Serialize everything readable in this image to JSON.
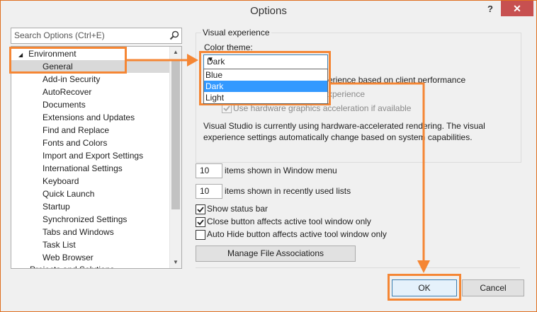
{
  "window": {
    "title": "Options",
    "help": "?",
    "close": "✕"
  },
  "search": {
    "placeholder": "Search Options (Ctrl+E)"
  },
  "tree": {
    "root": "Environment",
    "items": [
      "General",
      "Add-in Security",
      "AutoRecover",
      "Documents",
      "Extensions and Updates",
      "Find and Replace",
      "Fonts and Colors",
      "Import and Export Settings",
      "International Settings",
      "Keyboard",
      "Quick Launch",
      "Startup",
      "Synchronized Settings",
      "Tabs and Windows",
      "Task List",
      "Web Browser"
    ],
    "next_partial": "Projects and Solutions"
  },
  "visual": {
    "group_title": "Visual experience",
    "color_theme_label": "Color theme:",
    "selected_theme": "Dark",
    "theme_options": [
      "Blue",
      "Dark",
      "Light"
    ],
    "auto_adjust_partial": "erience based on client performance",
    "rich_partial": "xperience",
    "hw_accel": "Use hardware graphics acceleration if available",
    "status_line1": "Visual Studio is currently using hardware-accelerated rendering. The visual",
    "status_line2": "experience settings automatically change based on system capabilities."
  },
  "window_menu": {
    "value": "10",
    "label": "items shown in Window menu"
  },
  "mru": {
    "value": "10",
    "label": "items shown in recently used lists"
  },
  "checks": {
    "status_bar": "Show status bar",
    "close_button": "Close button affects active tool window only",
    "auto_hide": "Auto Hide button affects active tool window only"
  },
  "buttons": {
    "manage": "Manage File Associations",
    "ok": "OK",
    "cancel": "Cancel"
  },
  "colors": {
    "highlight": "#f58634",
    "selection": "#3399ff"
  }
}
